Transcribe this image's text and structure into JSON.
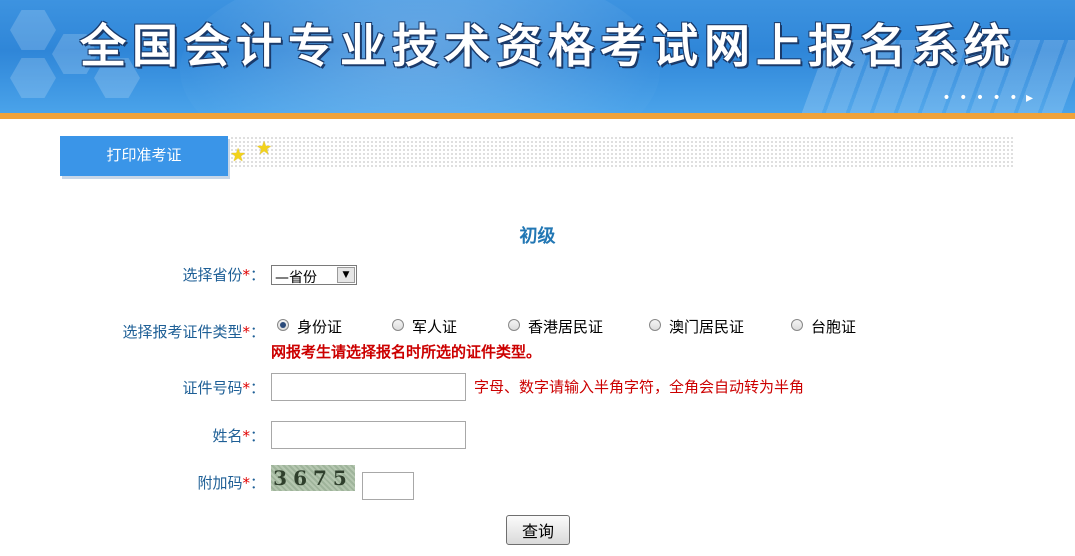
{
  "header": {
    "title": "全国会计专业技术资格考试网上报名系统",
    "decor_dots": "• • • • • ▸"
  },
  "tabs": [
    {
      "label": "打印准考证",
      "active": true
    }
  ],
  "form": {
    "level": "初级",
    "province": {
      "label": "选择省份",
      "required": "*",
      "colon": "：",
      "selected": "—省份"
    },
    "id_type": {
      "label": "选择报考证件类型",
      "required": "*",
      "colon": "：",
      "options": [
        "身份证",
        "军人证",
        "香港居民证",
        "澳门居民证",
        "台胞证"
      ],
      "selected_index": 0,
      "warning": "网报考生请选择报名时所选的证件类型。"
    },
    "id_number": {
      "label": "证件号码",
      "required": "*",
      "colon": "：",
      "value": "",
      "hint": "字母、数字请输入半角字符，全角会自动转为半角"
    },
    "name": {
      "label": "姓名",
      "required": "*",
      "colon": "：",
      "value": ""
    },
    "captcha": {
      "label": "附加码",
      "required": "*",
      "colon": "：",
      "image_text": "3675",
      "value": ""
    },
    "submit_label": "查询"
  },
  "colors": {
    "banner_blue": "#2f86d8",
    "accent_orange": "#f0a23a",
    "tab_blue": "#3a95e8",
    "label_blue": "#1e5f96",
    "warning_red": "#cc0000"
  }
}
